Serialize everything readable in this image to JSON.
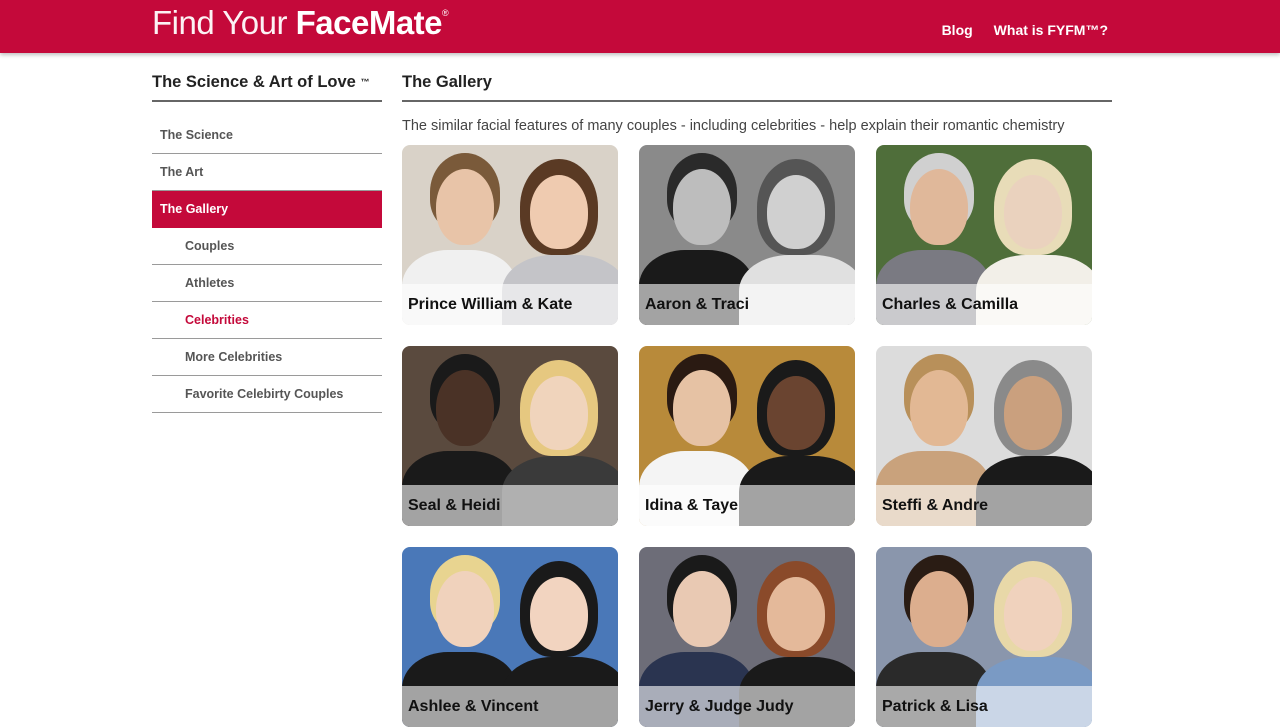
{
  "header": {
    "logo_thin": "Find Your ",
    "logo_bold": "FaceMate",
    "logo_mark": "®",
    "nav": [
      {
        "label": "Blog"
      },
      {
        "label": "What is FYFM™?"
      }
    ],
    "color": "#c4093a"
  },
  "sidebar": {
    "title": "The Science & Art of Love",
    "title_mark": "™",
    "items": [
      {
        "label": "The Science",
        "level": 0,
        "state": "normal"
      },
      {
        "label": "The Art",
        "level": 0,
        "state": "normal"
      },
      {
        "label": "The Gallery",
        "level": 0,
        "state": "active"
      },
      {
        "label": "Couples",
        "level": 1,
        "state": "normal"
      },
      {
        "label": "Athletes",
        "level": 1,
        "state": "normal"
      },
      {
        "label": "Celebrities",
        "level": 1,
        "state": "current"
      },
      {
        "label": "More Celebrities",
        "level": 1,
        "state": "normal"
      },
      {
        "label": "Favorite Celebirty Couples",
        "level": 1,
        "state": "normal"
      }
    ]
  },
  "main": {
    "title": "The Gallery",
    "intro": "The similar facial features of many couples - including celebrities - help explain their romantic chemistry",
    "gallery": [
      {
        "caption": "Prince William & Kate",
        "bg": "#d9d2c8",
        "tone": "color"
      },
      {
        "caption": "Aaron & Traci",
        "bg": "#8a8a8a",
        "tone": "bw"
      },
      {
        "caption": "Charles & Camilla",
        "bg": "#4f6e3a",
        "tone": "color"
      },
      {
        "caption": "Seal & Heidi",
        "bg": "#5a4a3e",
        "tone": "color"
      },
      {
        "caption": "Idina & Taye",
        "bg": "#b88a3a",
        "tone": "color"
      },
      {
        "caption": "Steffi & Andre",
        "bg": "#dcdcdc",
        "tone": "color"
      },
      {
        "caption": "Ashlee & Vincent",
        "bg": "#4a78b8",
        "tone": "color"
      },
      {
        "caption": "Jerry & Judge Judy",
        "bg": "#6d6d78",
        "tone": "color"
      },
      {
        "caption": "Patrick & Lisa",
        "bg": "#8a96ac",
        "tone": "color"
      }
    ]
  }
}
